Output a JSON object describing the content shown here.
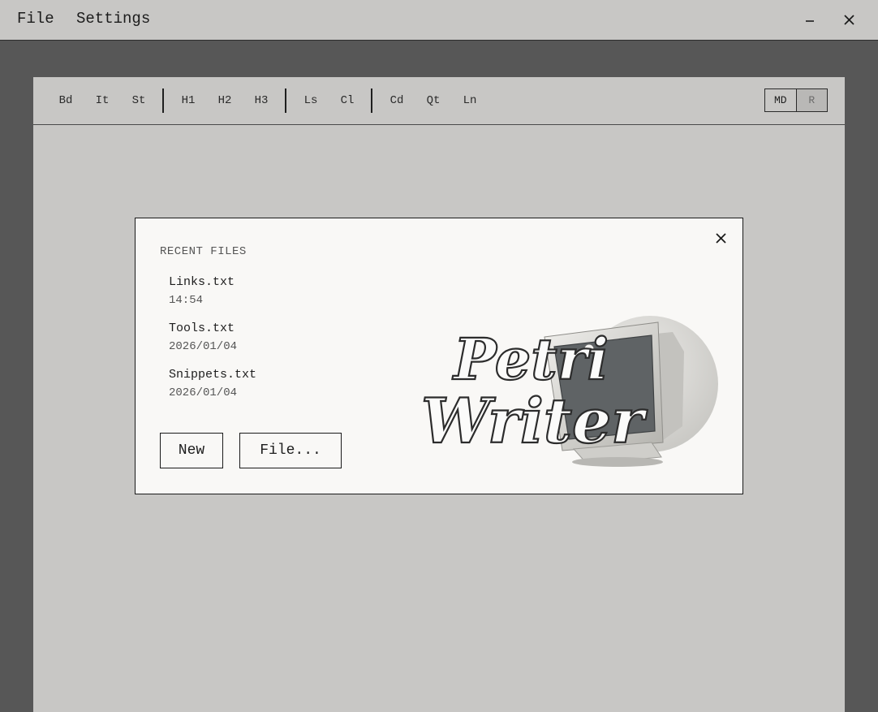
{
  "menu": {
    "file_label": "File",
    "settings_label": "Settings"
  },
  "window": {
    "minimize_icon": "minimize-icon",
    "close_icon": "close-icon"
  },
  "toolbar": {
    "groups": [
      [
        "Bd",
        "It",
        "St"
      ],
      [
        "H1",
        "H2",
        "H3"
      ],
      [
        "Ls",
        "Cl"
      ],
      [
        "Cd",
        "Qt",
        "Ln"
      ]
    ],
    "mode_md": "MD",
    "mode_r": "R",
    "active_mode": "MD"
  },
  "dialog": {
    "title": "RECENT FILES",
    "recent": [
      {
        "name": "Links.txt",
        "date": "14:54"
      },
      {
        "name": "Tools.txt",
        "date": "2026/01/04"
      },
      {
        "name": "Snippets.txt",
        "date": "2026/01/04"
      }
    ],
    "new_label": "New",
    "file_label": "File...",
    "logo_text_line1": "Petri",
    "logo_text_line2": "Writer"
  },
  "colors": {
    "background": "#575757",
    "chrome": "#c8c7c5",
    "dialog": "#f9f8f6",
    "ink": "#1e1e1e"
  }
}
